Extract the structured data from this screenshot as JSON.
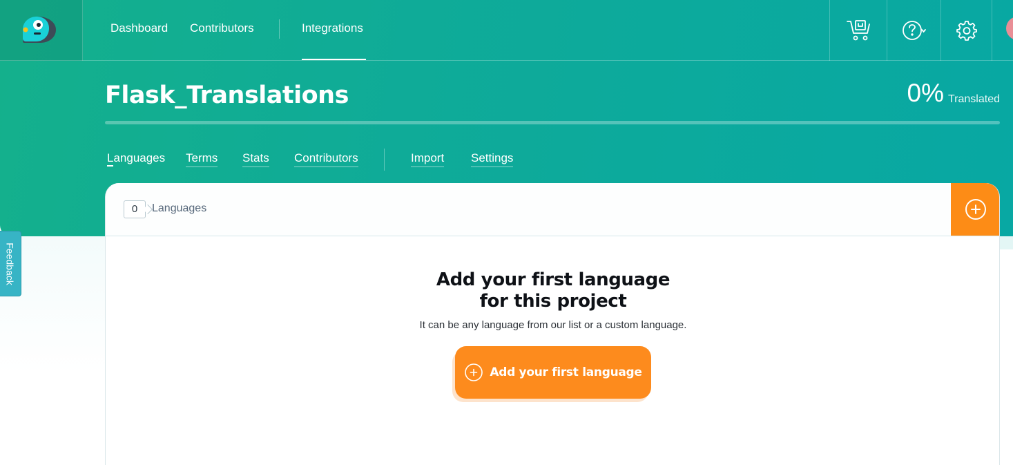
{
  "topnav": {
    "links": [
      {
        "label": "Dashboard"
      },
      {
        "label": "Contributors"
      },
      {
        "label": "Integrations"
      }
    ],
    "icons": [
      "cart-icon",
      "help-icon",
      "gear-icon"
    ]
  },
  "project": {
    "title": "Flask_Translations",
    "percent": "0%",
    "percent_label": "Translated",
    "progress": 0
  },
  "subnav": {
    "links": [
      {
        "label": "Languages"
      },
      {
        "label": "Terms"
      },
      {
        "label": "Stats"
      },
      {
        "label": "Contributors"
      },
      {
        "label": "Import"
      },
      {
        "label": "Settings"
      }
    ]
  },
  "card": {
    "count": "0",
    "count_label": "Languages",
    "empty_title_line1": "Add your first language",
    "empty_title_line2": "for this project",
    "empty_subtitle": "It can be any language from our list or a custom language.",
    "cta_label": "Add your first language"
  },
  "feedback": {
    "label": "Feedback"
  },
  "colors": {
    "accent": "#fd8b1d",
    "brand_teal": "#0fab98"
  }
}
